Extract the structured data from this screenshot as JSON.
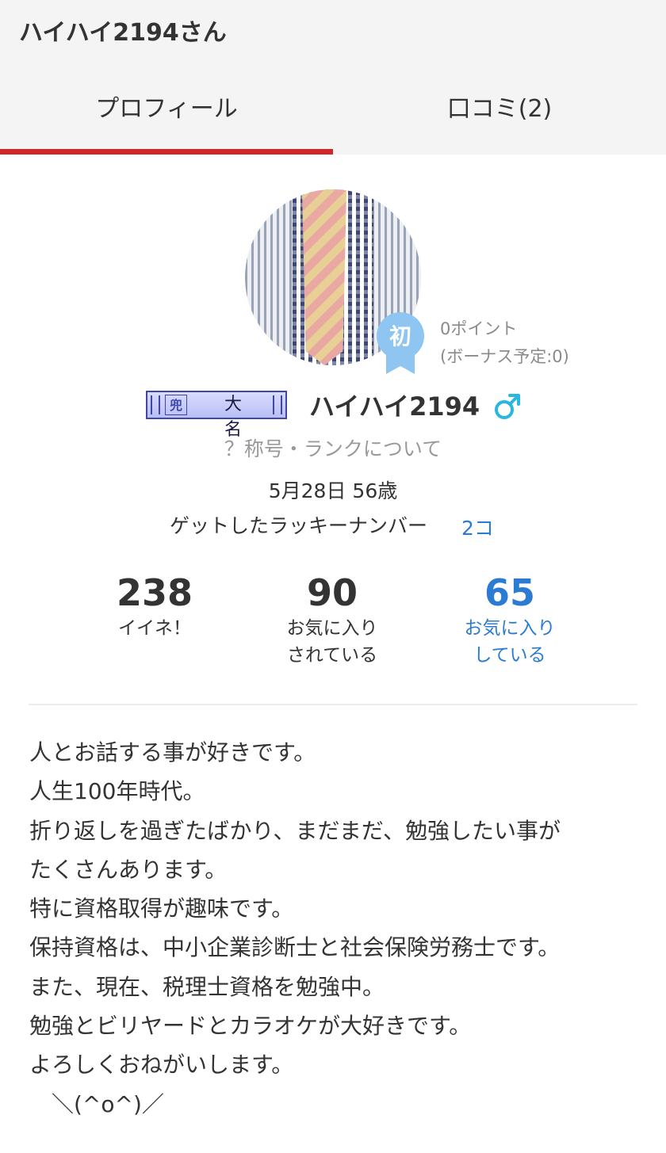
{
  "header": {
    "title": "ハイハイ2194さん"
  },
  "tabs": [
    {
      "label": "プロフィール",
      "active": true
    },
    {
      "label": "口コミ(2)",
      "active": false
    }
  ],
  "colors": {
    "accent_red": "#d0262a",
    "link_blue": "#2b7bd3",
    "badge_blue": "#8ec6f1"
  },
  "profile": {
    "beginner_badge": "初",
    "points": "0ポイント",
    "bonus": "(ボーナス予定:0)",
    "rank_glyph": "兜",
    "rank_name": "大名",
    "username": "ハイハイ2194",
    "gender_icon": "male-symbol-icon",
    "rank_link": "？称号・ランクについて",
    "birthday": "5月28日 56歳",
    "lucky_label": "ゲットしたラッキーナンバー",
    "lucky_count": "2コ"
  },
  "stats": [
    {
      "value": "238",
      "label_line1": "イイネ！",
      "label_line2": ""
    },
    {
      "value": "90",
      "label_line1": "お気に入り",
      "label_line2": "されている"
    },
    {
      "value": "65",
      "label_line1": "お気に入り",
      "label_line2": "している"
    }
  ],
  "bio": [
    "人とお話する事が好きです。",
    "人生100年時代。",
    "折り返しを過ぎたばかり、まだまだ、勉強したい事が",
    "たくさんあります。",
    "特に資格取得が趣味です。",
    "保持資格は、中小企業診断士と社会保険労務士です。",
    "また、現在、税理士資格を勉強中。",
    "勉強とビリヤードとカラオケが大好きです。",
    "よろしくおねがいします。",
    "　＼(^o^)／"
  ]
}
